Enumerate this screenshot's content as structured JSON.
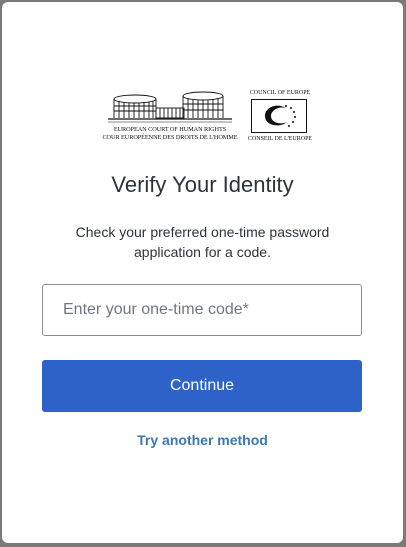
{
  "logos": {
    "echr_line1": "EUROPEAN COURT OF HUMAN RIGHTS",
    "echr_line2": "COUR EUROPÉENNE DES DROITS DE L'HOMME",
    "coe_top": "COUNCIL OF EUROPE",
    "coe_bottom": "CONSEIL DE L'EUROPE"
  },
  "page": {
    "title": "Verify Your Identity",
    "description_line1": "Check your preferred one-time password",
    "description_line2": "application for a code."
  },
  "form": {
    "code_placeholder": "Enter your one-time code*",
    "code_value": "",
    "continue_label": "Continue",
    "alt_method_label": "Try another method"
  },
  "colors": {
    "primary": "#2d62c8",
    "link": "#3a76b0",
    "text": "#2d333a"
  }
}
